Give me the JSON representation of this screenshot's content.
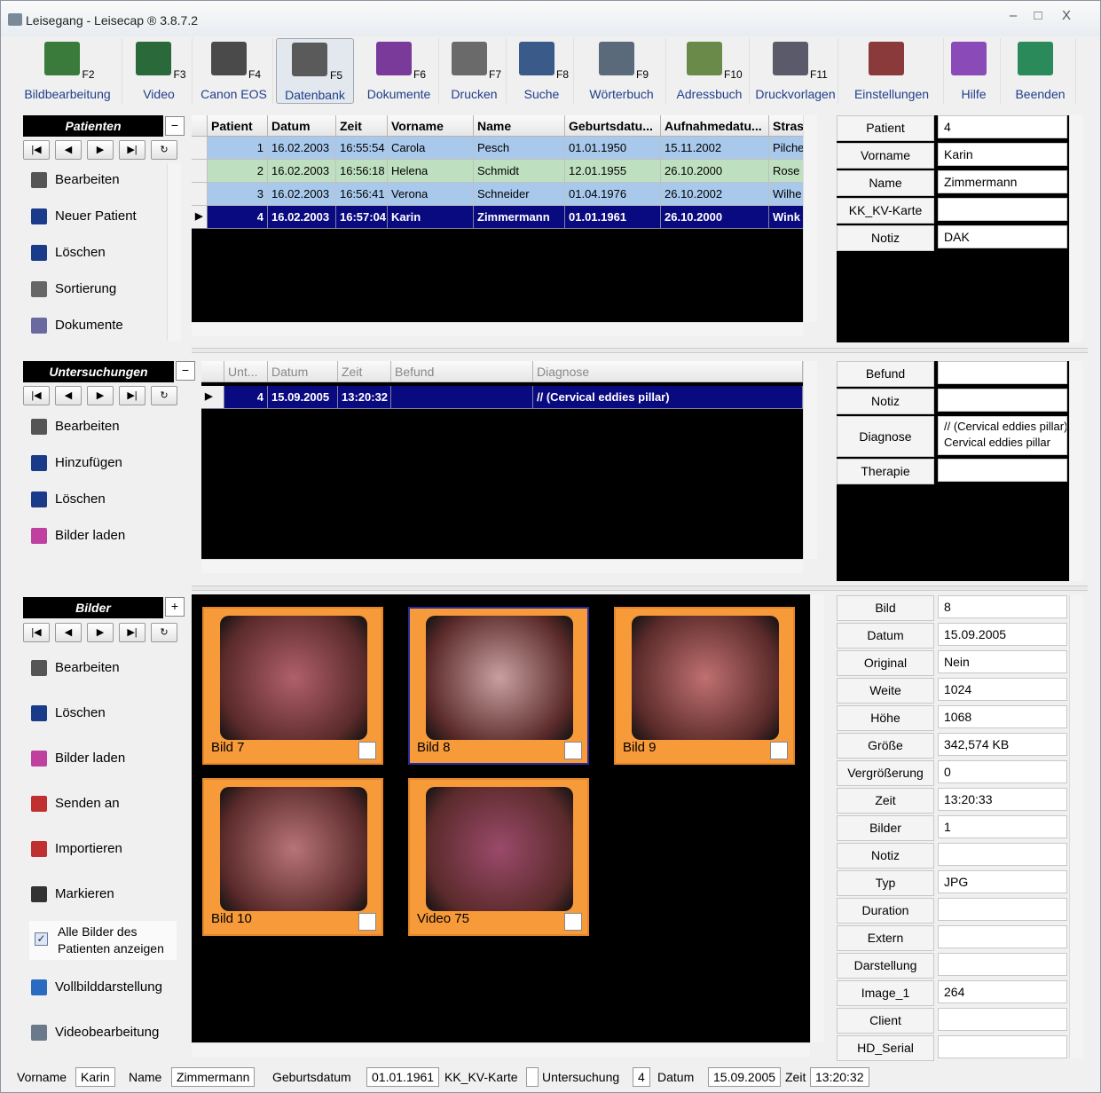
{
  "app": {
    "title": "Leisegang - Leisecap ® 3.8.7.2"
  },
  "window_controls": {
    "minimize": "–",
    "maximize": "□",
    "close": "X"
  },
  "toolbar": [
    {
      "label": "Bildbearbeitung",
      "key": "F2",
      "icon": "image-edit-icon",
      "color": "#3a7a3a"
    },
    {
      "label": "Video",
      "key": "F3",
      "icon": "video-camera-icon",
      "color": "#2a6a3a"
    },
    {
      "label": "Canon EOS",
      "key": "F4",
      "icon": "photo-camera-icon",
      "color": "#4a4a4a"
    },
    {
      "label": "Datenbank",
      "key": "F5",
      "icon": "database-tree-icon",
      "color": "#5a5a5a"
    },
    {
      "label": "Dokumente",
      "key": "F6",
      "icon": "documents-icon",
      "color": "#7a3a9a"
    },
    {
      "label": "Drucken",
      "key": "F7",
      "icon": "printer-icon",
      "color": "#6a6a6a"
    },
    {
      "label": "Suche",
      "key": "F8",
      "icon": "search-icon",
      "color": "#3a5a8a"
    },
    {
      "label": "Wörterbuch",
      "key": "F9",
      "icon": "dictionary-icon",
      "color": "#5a6a7a"
    },
    {
      "label": "Adressbuch",
      "key": "F10",
      "icon": "address-book-icon",
      "color": "#6a8a4a"
    },
    {
      "label": "Druckvorlagen",
      "key": "F11",
      "icon": "print-templates-icon",
      "color": "#5a5a6a"
    },
    {
      "label": "Einstellungen",
      "key": "",
      "icon": "settings-checklist-icon",
      "color": "#8a3a3a"
    },
    {
      "label": "Hilfe",
      "key": "",
      "icon": "help-book-icon",
      "color": "#8a4ab8"
    },
    {
      "label": "Beenden",
      "key": "",
      "icon": "exit-door-icon",
      "color": "#2a8a5a"
    }
  ],
  "patients_panel": {
    "title": "Patienten",
    "actions": [
      "Bearbeiten",
      "Neuer Patient",
      "Löschen",
      "Sortierung",
      "Dokumente"
    ],
    "columns": [
      "Patient",
      "Datum",
      "Zeit",
      "Vorname",
      "Name",
      "Geburtsdatu...",
      "Aufnahmedatu...",
      "Stras"
    ],
    "sort_markers": {
      "vorname": "2",
      "name": "1"
    },
    "rows": [
      [
        "1",
        "16.02.2003",
        "16:55:54",
        "Carola",
        "Pesch",
        "01.01.1950",
        "15.11.2002",
        "Pilche"
      ],
      [
        "2",
        "16.02.2003",
        "16:56:18",
        "Helena",
        "Schmidt",
        "12.01.1955",
        "26.10.2000",
        "Rose"
      ],
      [
        "3",
        "16.02.2003",
        "16:56:41",
        "Verona",
        "Schneider",
        "01.04.1976",
        "26.10.2002",
        "Wilhe"
      ],
      [
        "4",
        "16.02.2003",
        "16:57:04",
        "Karin",
        "Zimmermann",
        "01.01.1961",
        "26.10.2000",
        "Wink"
      ]
    ],
    "row_colors": [
      "#a9c9ec",
      "#bfe0c0",
      "#a9c9ec",
      "#0a0a80"
    ],
    "selected_row": 3
  },
  "patient_props": [
    {
      "label": "Patient",
      "value": "4"
    },
    {
      "label": "Vorname",
      "value": "Karin"
    },
    {
      "label": "Name",
      "value": "Zimmermann"
    },
    {
      "label": "KK_KV-Karte",
      "value": ""
    },
    {
      "label": "Notiz",
      "value": "DAK"
    }
  ],
  "exam_panel": {
    "title": "Untersuchungen",
    "actions": [
      "Bearbeiten",
      "Hinzufügen",
      "Löschen",
      "Bilder laden"
    ],
    "columns": [
      "Unt...",
      "Datum",
      "Zeit",
      "Befund",
      "Diagnose"
    ],
    "sort_markers": {
      "datum": "1",
      "zeit": "2"
    },
    "rows": [
      [
        "4",
        "15.09.2005",
        "13:20:32",
        "",
        "// (Cervical eddies pillar)"
      ]
    ]
  },
  "exam_props": [
    {
      "label": "Befund",
      "value": ""
    },
    {
      "label": "Notiz",
      "value": ""
    },
    {
      "label": "Diagnose",
      "value": "// (Cervical eddies pillar)",
      "value2": "Cervical eddies pillar"
    },
    {
      "label": "Therapie",
      "value": ""
    }
  ],
  "images_panel": {
    "title": "Bilder",
    "add_symbol": "+",
    "actions": [
      "Bearbeiten",
      "Löschen",
      "Bilder laden",
      "Senden an",
      "Importieren",
      "Markieren"
    ],
    "show_all_checkbox": {
      "label_line1": "Alle Bilder des",
      "label_line2": "Patienten anzeigen",
      "checked": true
    },
    "more_actions": [
      "Vollbilddarstellung",
      "Videobearbeitung"
    ],
    "thumbnails": [
      {
        "caption": "Bild 7",
        "tone": "#b0606a"
      },
      {
        "caption": "Bild 8",
        "tone": "#c9a0a0"
      },
      {
        "caption": "Bild 9",
        "tone": "#c07070"
      },
      {
        "caption": "Bild 10",
        "tone": "#b87478"
      },
      {
        "caption": "Video 75",
        "tone": "#9a4a6a"
      }
    ]
  },
  "image_props": [
    {
      "label": "Bild",
      "value": "8"
    },
    {
      "label": "Datum",
      "value": "15.09.2005"
    },
    {
      "label": "Original",
      "value": "Nein"
    },
    {
      "label": "Weite",
      "value": "1024"
    },
    {
      "label": "Höhe",
      "value": "1068"
    },
    {
      "label": "Größe",
      "value": "342,574 KB"
    },
    {
      "label": "Vergrößerung",
      "value": "0"
    },
    {
      "label": "Zeit",
      "value": "13:20:33"
    },
    {
      "label": "Bilder",
      "value": "1"
    },
    {
      "label": "Notiz",
      "value": ""
    },
    {
      "label": "Typ",
      "value": "JPG"
    },
    {
      "label": "Duration",
      "value": ""
    },
    {
      "label": "Extern",
      "value": ""
    },
    {
      "label": "Darstellung",
      "value": ""
    },
    {
      "label": "Image_1",
      "value": "264"
    },
    {
      "label": "Client",
      "value": ""
    },
    {
      "label": "HD_Serial",
      "value": ""
    }
  ],
  "statusbar": [
    {
      "label": "Vorname",
      "value": "Karin"
    },
    {
      "label": "Name",
      "value": "Zimmermann"
    },
    {
      "label": "Geburtsdatum",
      "value": "01.01.1961"
    },
    {
      "label": "KK_KV-Karte",
      "value": ""
    },
    {
      "label": "Untersuchung",
      "value": "4"
    },
    {
      "label": "Datum",
      "value": "15.09.2005"
    },
    {
      "label": "Zeit",
      "value": "13:20:32"
    }
  ]
}
